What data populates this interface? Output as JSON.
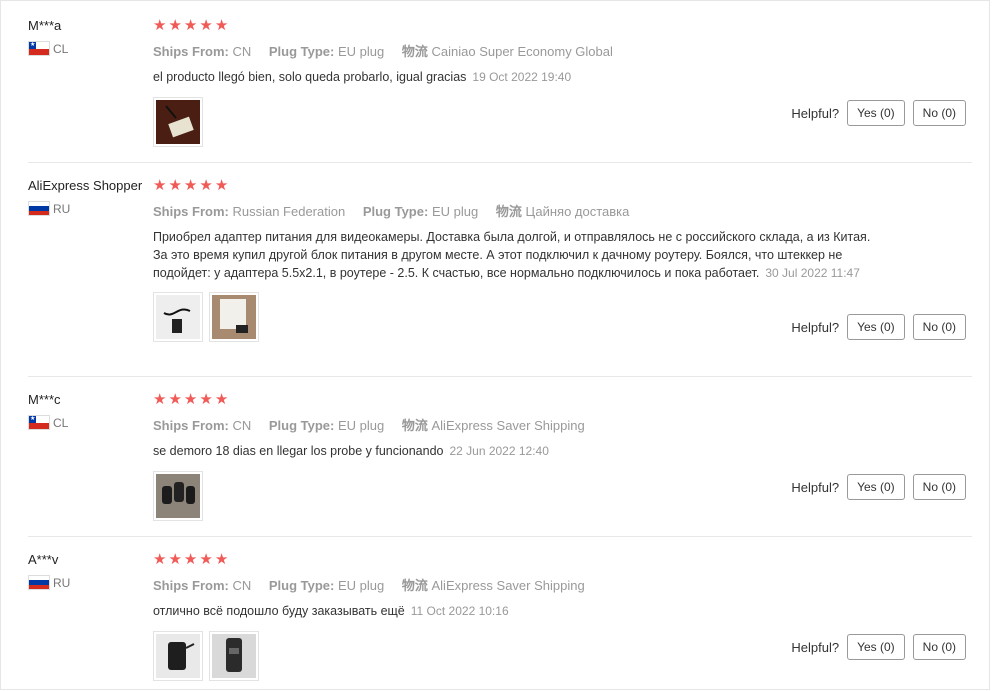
{
  "reviews": [
    {
      "user": "M***a",
      "country": "CL",
      "country_flag": "chile-flag",
      "rating": 5,
      "ships_from_label": "Ships From:",
      "ships_from": "CN",
      "plug_type_label": "Plug Type:",
      "plug_type": "EU plug",
      "logistics_label": "物流",
      "logistics": "Cainiao Super Economy Global",
      "text": "el producto llegó bien, solo queda probarlo, igual gracias",
      "date": "19 Oct 2022 19:40",
      "photos": 1,
      "helpful_label": "Helpful?",
      "yes_label": "Yes (0)",
      "no_label": "No (0)"
    },
    {
      "user": "AliExpress Shopper",
      "country": "RU",
      "country_flag": "russia-flag",
      "rating": 5,
      "ships_from_label": "Ships From:",
      "ships_from": "Russian Federation",
      "plug_type_label": "Plug Type:",
      "plug_type": "EU plug",
      "logistics_label": "物流",
      "logistics": "Цайняо доставка",
      "text": "Приобрел адаптер питания для видеокамеры. Доставка была долгой, и отправлялось не с российского склада, а из Китая. За это время купил другой блок питания в другом месте. А этот подключил к дачному роутеру. Боялся, что штеккер не подойдет: у адаптера 5.5x2.1, в роутере - 2.5. К счастью, все нормально подключилось и пока работает.",
      "date": "30 Jul 2022 11:47",
      "photos": 2,
      "helpful_label": "Helpful?",
      "yes_label": "Yes (0)",
      "no_label": "No (0)"
    },
    {
      "user": "M***c",
      "country": "CL",
      "country_flag": "chile-flag",
      "rating": 5,
      "ships_from_label": "Ships From:",
      "ships_from": "CN",
      "plug_type_label": "Plug Type:",
      "plug_type": "EU plug",
      "logistics_label": "物流",
      "logistics": "AliExpress Saver Shipping",
      "text": "se demoro 18 dias en llegar los probe y funcionando",
      "date": "22 Jun 2022 12:40",
      "photos": 1,
      "helpful_label": "Helpful?",
      "yes_label": "Yes (0)",
      "no_label": "No (0)"
    },
    {
      "user": "A***v",
      "country": "RU",
      "country_flag": "russia-flag",
      "rating": 5,
      "ships_from_label": "Ships From:",
      "ships_from": "CN",
      "plug_type_label": "Plug Type:",
      "plug_type": "EU plug",
      "logistics_label": "物流",
      "logistics": "AliExpress Saver Shipping",
      "text": "отлично всё подошло буду заказывать ещё",
      "date": "11 Oct 2022 10:16",
      "photos": 2,
      "helpful_label": "Helpful?",
      "yes_label": "Yes (0)",
      "no_label": "No (0)"
    }
  ],
  "colors": {
    "star": "#f05a57",
    "muted": "#999999",
    "separator": "#e8e8e8"
  }
}
